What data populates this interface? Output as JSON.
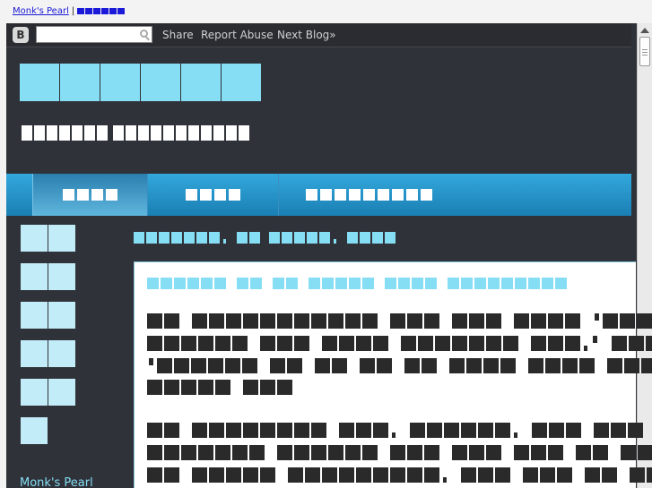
{
  "top_bar": {
    "blog_link": "Monk's Pearl",
    "separator": "|"
  },
  "navbar": {
    "logo": "B",
    "search_placeholder": "",
    "links": [
      "Share",
      "Report Abuse",
      "Next Blog»"
    ]
  },
  "sidebar": {
    "title": "Monk's Pearl"
  },
  "colors": {
    "accent": "#86def4",
    "tabbar": "#2594cc",
    "background": "#2f3239",
    "post_background": "#ffffff"
  },
  "icons": {
    "search": "search-icon",
    "blogger": "blogger-logo-icon"
  }
}
